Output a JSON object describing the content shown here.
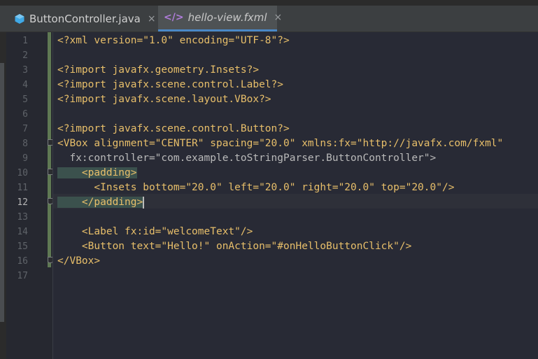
{
  "editor": {
    "tabs": [
      {
        "label": "ButtonController.java",
        "icon": "java-class-icon",
        "active": false
      },
      {
        "label": "hello-view.fxml",
        "icon": "fxml-icon",
        "active": true
      }
    ],
    "icon_color": "#40a9e6",
    "fxml_icon_glyph": "</>",
    "close_glyph": "×",
    "current_line": 12,
    "line_numbers": [
      "1",
      "2",
      "3",
      "4",
      "5",
      "6",
      "7",
      "8",
      "9",
      "10",
      "11",
      "12",
      "13",
      "14",
      "15",
      "16",
      "17"
    ],
    "lines": [
      "<?xml version=\"1.0\" encoding=\"UTF-8\"?>",
      "",
      "<?import javafx.geometry.Insets?>",
      "<?import javafx.scene.control.Label?>",
      "<?import javafx.scene.layout.VBox?>",
      "",
      "<?import javafx.scene.control.Button?>",
      "<VBox alignment=\"CENTER\" spacing=\"20.0\" xmlns:fx=\"http://javafx.com/fxml\"",
      "  fx:controller=\"com.example.toStringParser.ButtonController\">",
      "    <padding>",
      "      <Insets bottom=\"20.0\" left=\"20.0\" right=\"20.0\" top=\"20.0\"/>",
      "    </padding>",
      "",
      "    <Label fx:id=\"welcomeText\"/>",
      "    <Button text=\"Hello!\" onAction=\"#onHelloButtonClick\"/>",
      "</VBox>",
      ""
    ]
  }
}
